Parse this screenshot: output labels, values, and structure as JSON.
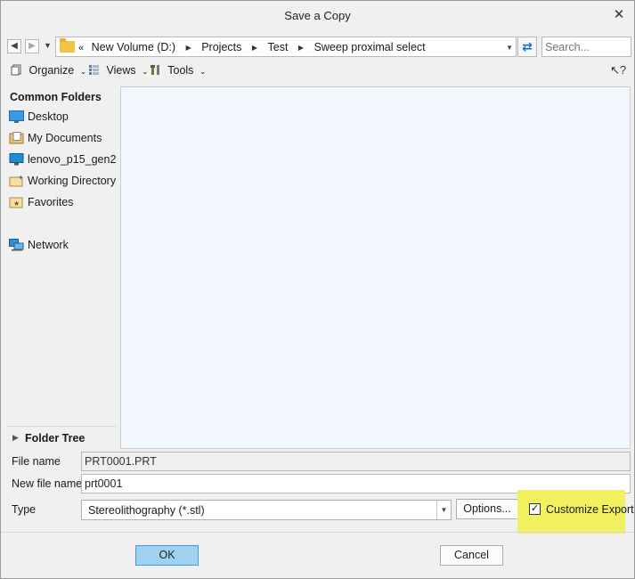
{
  "window": {
    "title": "Save a Copy",
    "close_glyph": "✕"
  },
  "nav": {
    "back_icon": "arrow-left-icon",
    "forward_icon": "arrow-right-icon",
    "crumbs": [
      "New Volume (D:)",
      "Projects",
      "Test",
      "Sweep proximal select"
    ],
    "search_placeholder": "Search..."
  },
  "toolbar": {
    "organize": "Organize",
    "views": "Views",
    "tools": "Tools"
  },
  "sidebar": {
    "heading": "Common Folders",
    "items": [
      {
        "label": "Desktop",
        "icon": "desktop-icon"
      },
      {
        "label": "My Documents",
        "icon": "documents-icon"
      },
      {
        "label": "lenovo_p15_gen2",
        "icon": "computer-icon"
      },
      {
        "label": "Working Directory",
        "icon": "working-directory-icon"
      },
      {
        "label": "Favorites",
        "icon": "favorites-icon"
      },
      {
        "label": "Network",
        "icon": "network-icon"
      }
    ],
    "folder_tree": "Folder Tree"
  },
  "form": {
    "file_name_label": "File name",
    "file_name_value": "PRT0001.PRT",
    "new_file_name_label": "New file name",
    "new_file_name_value": "prt0001",
    "type_label": "Type",
    "type_value": "Stereolithography (*.stl)",
    "options_button": "Options...",
    "customize_export_label": "Customize Export",
    "customize_export_checked": true
  },
  "buttons": {
    "ok": "OK",
    "cancel": "Cancel"
  },
  "colors": {
    "highlight": "#f1f05f",
    "ok_button": "#9fd2f0",
    "file_list_bg": "#f1f7fc"
  }
}
